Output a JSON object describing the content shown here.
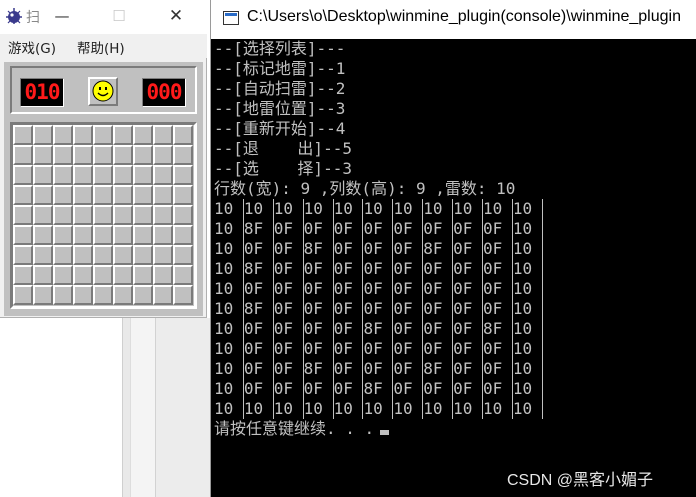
{
  "minesweeper": {
    "title": "扫",
    "menu": {
      "game": "游戏(G)",
      "help": "帮助(H)"
    },
    "mine_counter": "010",
    "timer": "000",
    "rows": 9,
    "cols": 9
  },
  "console": {
    "title": "C:\\Users\\o\\Desktop\\winmine_plugin(console)\\winmine_plugin",
    "menu_lines": [
      "--[选择列表]---",
      "--[标记地雷]--1",
      "--[自动扫雷]--2",
      "--[地雷位置]--3",
      "--[重新开始]--4",
      "--[退    出]--5",
      "--[选    择]--3",
      "行数(宽): 9 ,列数(高): 9 ,雷数: 10"
    ],
    "memory_grid": [
      [
        "10",
        "10",
        "10",
        "10",
        "10",
        "10",
        "10",
        "10",
        "10",
        "10",
        "10"
      ],
      [
        "10",
        "8F",
        "0F",
        "0F",
        "0F",
        "0F",
        "0F",
        "0F",
        "0F",
        "0F",
        "10"
      ],
      [
        "10",
        "0F",
        "0F",
        "8F",
        "0F",
        "0F",
        "0F",
        "8F",
        "0F",
        "0F",
        "10"
      ],
      [
        "10",
        "8F",
        "0F",
        "0F",
        "0F",
        "0F",
        "0F",
        "0F",
        "0F",
        "0F",
        "10"
      ],
      [
        "10",
        "0F",
        "0F",
        "0F",
        "0F",
        "0F",
        "0F",
        "0F",
        "0F",
        "0F",
        "10"
      ],
      [
        "10",
        "8F",
        "0F",
        "0F",
        "0F",
        "0F",
        "0F",
        "0F",
        "0F",
        "0F",
        "10"
      ],
      [
        "10",
        "0F",
        "0F",
        "0F",
        "0F",
        "8F",
        "0F",
        "0F",
        "0F",
        "8F",
        "10"
      ],
      [
        "10",
        "0F",
        "0F",
        "0F",
        "0F",
        "0F",
        "0F",
        "0F",
        "0F",
        "0F",
        "10"
      ],
      [
        "10",
        "0F",
        "0F",
        "8F",
        "0F",
        "0F",
        "0F",
        "8F",
        "0F",
        "0F",
        "10"
      ],
      [
        "10",
        "0F",
        "0F",
        "0F",
        "0F",
        "8F",
        "0F",
        "0F",
        "0F",
        "0F",
        "10"
      ],
      [
        "10",
        "10",
        "10",
        "10",
        "10",
        "10",
        "10",
        "10",
        "10",
        "10",
        "10"
      ]
    ],
    "prompt": "请按任意键继续. . ."
  },
  "watermark": "CSDN @黑客小媚子"
}
